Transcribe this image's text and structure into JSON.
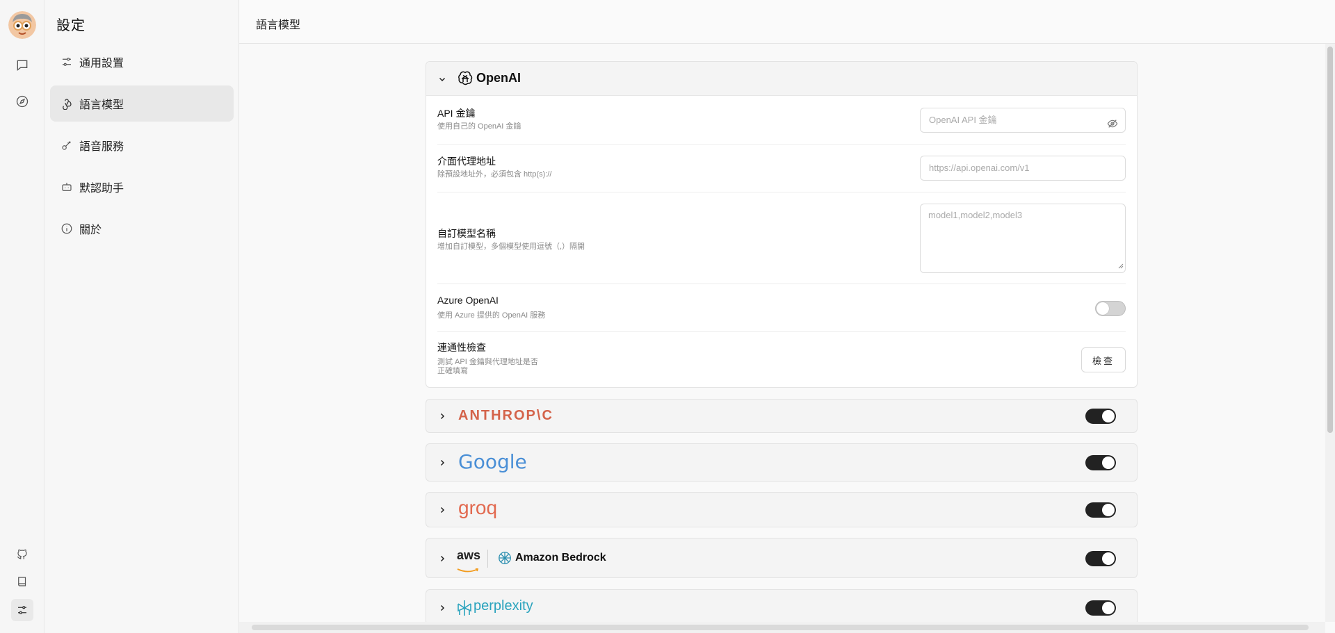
{
  "settings": {
    "title": "設定",
    "menu": [
      {
        "label": "通用設置",
        "icon": "sliders-icon"
      },
      {
        "label": "語言模型",
        "icon": "webhook-icon"
      },
      {
        "label": "語音服務",
        "icon": "key-icon"
      },
      {
        "label": "默認助手",
        "icon": "bot-icon"
      },
      {
        "label": "關於",
        "icon": "info-icon"
      }
    ],
    "active_index": 1
  },
  "rail": {
    "icons": [
      "avatar",
      "chat-icon",
      "compass-icon",
      "github-icon",
      "book-icon",
      "settings-sliders-icon"
    ]
  },
  "header": {
    "title": "語言模型"
  },
  "openai": {
    "name": "OpenAI",
    "api_key": {
      "label": "API 金鑰",
      "desc": "使用自己的 OpenAI 金鑰",
      "placeholder": "OpenAI API 金鑰"
    },
    "proxy": {
      "label": "介面代理地址",
      "desc": "除預設地址外，必須包含 http(s)://",
      "placeholder": "https://api.openai.com/v1"
    },
    "custom_models": {
      "label": "自訂模型名稱",
      "desc": "增加自訂模型，多個模型使用逗號（,）隔開",
      "placeholder": "model1,model2,model3"
    },
    "azure": {
      "label": "Azure OpenAI",
      "desc": "使用 Azure 提供的 OpenAI 服務",
      "enabled": false
    },
    "check": {
      "label": "連通性檢查",
      "desc_line1": "測試 API 金鑰與代理地址是否",
      "desc_line2": "正確填寫",
      "button": "檢查"
    }
  },
  "providers": [
    {
      "name": "ANTHROP\\C",
      "enabled": true,
      "color": "#d4634a"
    },
    {
      "name": "Google",
      "enabled": true
    },
    {
      "name": "groq",
      "enabled": true,
      "color": "#e2694f"
    },
    {
      "name_left": "aws",
      "name_right": "Amazon Bedrock",
      "enabled": true
    },
    {
      "name": "perplexity",
      "enabled": true,
      "color": "#2aa3bd"
    }
  ],
  "colors": {
    "accent": "#222222",
    "toggle_off": "#d4d4d4"
  }
}
